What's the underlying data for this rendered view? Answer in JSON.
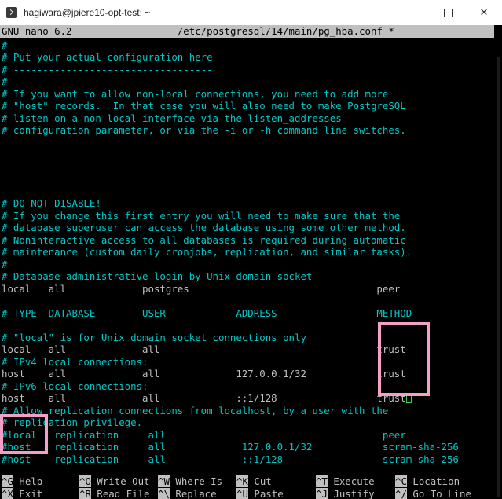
{
  "window": {
    "title": "hagiwara@jpiere10-opt-test: ~"
  },
  "nano": {
    "header_left": "GNU nano 6.2",
    "header_file": "/etc/postgresql/14/main/pg_hba.conf *"
  },
  "lines": [
    {
      "text": "#",
      "cls": "cyan"
    },
    {
      "text": "# Put your actual configuration here",
      "cls": "cyan"
    },
    {
      "text": "# ----------------------------------",
      "cls": "cyan"
    },
    {
      "text": "#",
      "cls": "cyan"
    },
    {
      "text": "# If you want to allow non-local connections, you need to add more",
      "cls": "cyan"
    },
    {
      "text": "# \"host\" records.  In that case you will also need to make PostgreSQL",
      "cls": "cyan"
    },
    {
      "text": "# listen on a non-local interface via the listen_addresses",
      "cls": "cyan"
    },
    {
      "text": "# configuration parameter, or via the -i or -h command line switches.",
      "cls": "cyan"
    },
    {
      "text": "",
      "cls": "cyan"
    },
    {
      "text": "",
      "cls": "cyan"
    },
    {
      "text": "",
      "cls": "cyan"
    },
    {
      "text": "",
      "cls": "cyan"
    },
    {
      "text": "",
      "cls": "cyan"
    },
    {
      "text": "# DO NOT DISABLE!",
      "cls": "cyan"
    },
    {
      "text": "# If you change this first entry you will need to make sure that the",
      "cls": "cyan"
    },
    {
      "text": "# database superuser can access the database using some other method.",
      "cls": "cyan"
    },
    {
      "text": "# Noninteractive access to all databases is required during automatic",
      "cls": "cyan"
    },
    {
      "text": "# maintenance (custom daily cronjobs, replication, and similar tasks).",
      "cls": "cyan"
    },
    {
      "text": "#",
      "cls": "cyan"
    },
    {
      "text": "# Database administrative login by Unix domain socket",
      "cls": "cyan"
    },
    {
      "text": "local   all             postgres                                peer",
      "cls": "grey"
    },
    {
      "text": "",
      "cls": "grey"
    },
    {
      "text": "# TYPE  DATABASE        USER            ADDRESS                 METHOD",
      "cls": "cyan"
    },
    {
      "text": "",
      "cls": "grey"
    },
    {
      "text": "# \"local\" is for Unix domain socket connections only",
      "cls": "cyan"
    },
    {
      "text": "local   all             all                                     trust",
      "cls": "grey"
    },
    {
      "text": "# IPv4 local connections:",
      "cls": "cyan"
    },
    {
      "text": "host    all             all             127.0.0.1/32            trust",
      "cls": "grey"
    },
    {
      "text": "# IPv6 local connections:",
      "cls": "cyan"
    },
    {
      "text": "host    all             all             ::1/128                 trust",
      "cls": "grey"
    },
    {
      "text": "# Allow replication connections from localhost, by a user with the",
      "cls": "cyan"
    },
    {
      "text": "# replication privilege.",
      "cls": "cyan"
    },
    {
      "text": "#local   replication     all                                     peer",
      "cls": "cyan"
    },
    {
      "text": "#host    replication     all             127.0.0.1/32            scram-sha-256",
      "cls": "cyan"
    },
    {
      "text": "#host    replication     all             ::1/128                 scram-sha-256",
      "cls": "cyan"
    }
  ],
  "shortcuts_row1": [
    {
      "key": "^G",
      "label": "Help"
    },
    {
      "key": "^O",
      "label": "Write Out"
    },
    {
      "key": "^W",
      "label": "Where Is"
    },
    {
      "key": "^K",
      "label": "Cut"
    },
    {
      "key": "^T",
      "label": "Execute"
    },
    {
      "key": "^C",
      "label": "Location"
    }
  ],
  "shortcuts_row2": [
    {
      "key": "^X",
      "label": "Exit"
    },
    {
      "key": "^R",
      "label": "Read File"
    },
    {
      "key": "^\\",
      "label": "Replace"
    },
    {
      "key": "^U",
      "label": "Paste"
    },
    {
      "key": "^J",
      "label": "Justify"
    },
    {
      "key": "^/",
      "label": "Go To Line"
    }
  ],
  "colors": {
    "background": "#000000",
    "comment": "#00c8c8",
    "text": "#c0c0c0",
    "highlight_box": "#f2a0c8",
    "cursor": "#3ad04a"
  }
}
